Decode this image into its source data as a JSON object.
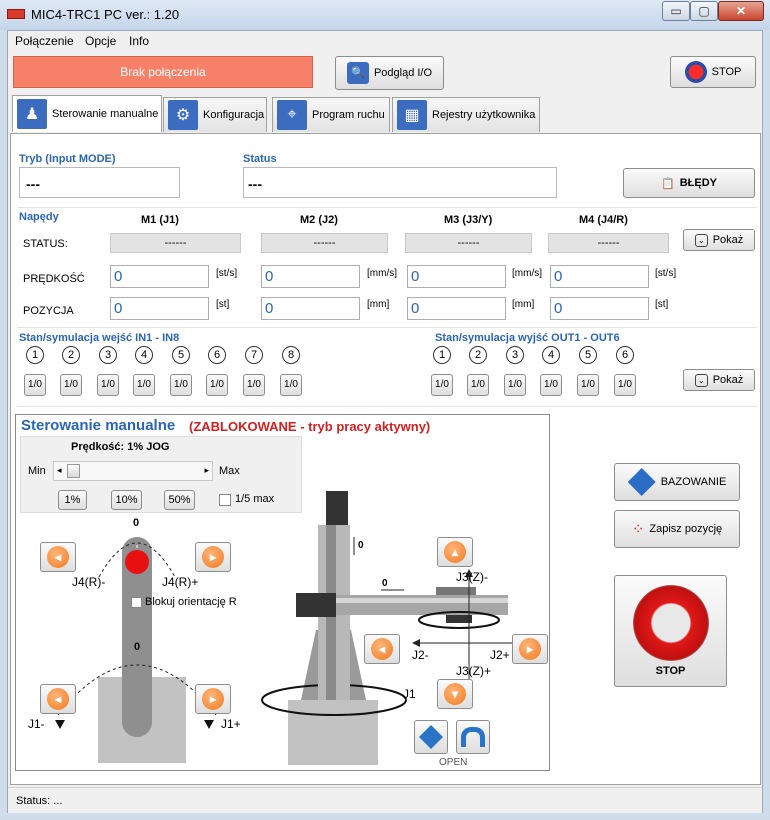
{
  "window": {
    "title": "MIC4-TRC1 PC  ver.: 1.20",
    "minimize": "▭",
    "maximize": "▢",
    "close": "✕"
  },
  "menu": [
    "Połączenie",
    "Opcje",
    "Info"
  ],
  "connection": {
    "status": "Brak połączenia"
  },
  "toolbar": {
    "io_preview": "Podgląd I/O",
    "stop": "STOP"
  },
  "tabs": [
    {
      "label": "Sterowanie manualne",
      "icon": "robot-icon"
    },
    {
      "label": "Konfiguracja",
      "icon": "gears-icon"
    },
    {
      "label": "Program ruchu",
      "icon": "path-icon"
    },
    {
      "label": "Rejestry użytkownika",
      "icon": "grid-icon"
    }
  ],
  "mode": {
    "label": "Tryb (Input MODE)",
    "value": "---"
  },
  "status": {
    "label": "Status",
    "value": "---"
  },
  "errors_button": "BŁĘDY",
  "drives": {
    "label": "Napędy",
    "show": "Pokaż",
    "row_labels": {
      "status": "STATUS:",
      "speed": "PRĘDKOŚĆ",
      "position": "POZYCJA"
    },
    "axes": [
      {
        "name": "M1 (J1)",
        "status": "------",
        "speed": "0",
        "speed_unit": "[st/s]",
        "position": "0",
        "position_unit": "[st]"
      },
      {
        "name": "M2 (J2)",
        "status": "------",
        "speed": "0",
        "speed_unit": "[mm/s]",
        "position": "0",
        "position_unit": "[mm]"
      },
      {
        "name": "M3 (J3/Y)",
        "status": "------",
        "speed": "0",
        "speed_unit": "[mm/s]",
        "position": "0",
        "position_unit": "[mm]"
      },
      {
        "name": "M4 (J4/R)",
        "status": "------",
        "speed": "0",
        "speed_unit": "[st/s]",
        "position": "0",
        "position_unit": "[st]"
      }
    ]
  },
  "inputs": {
    "label": "Stan/symulacja wejść IN1 - IN8",
    "numbers": [
      "1",
      "2",
      "3",
      "4",
      "5",
      "6",
      "7",
      "8"
    ],
    "button": "1/0"
  },
  "outputs": {
    "label": "Stan/symulacja wyjść OUT1 - OUT6",
    "numbers": [
      "1",
      "2",
      "3",
      "4",
      "5",
      "6"
    ],
    "button": "1/0",
    "show": "Pokaż"
  },
  "manual": {
    "title": "Sterowanie manualne",
    "locked": "(ZABLOKOWANE - tryb pracy aktywny)",
    "speed_label": "Prędkość:  1% JOG",
    "speed_percent": 0.01,
    "min": "Min",
    "max": "Max",
    "presets": [
      "1%",
      "10%",
      "50%"
    ],
    "fifth_max": "1/5 max",
    "j4_minus": "J4(R)-",
    "j4_plus": "J4(R)+",
    "lock_orientation": "Blokuj orientację R",
    "j1_minus": "J1-",
    "j1_plus": "J1+",
    "j1": "J1",
    "j2_minus": "J2-",
    "j2_plus": "J2+",
    "j3_minus": "J3(Z)-",
    "j3_plus": "J3(Z)+",
    "zero": "0",
    "open": "OPEN"
  },
  "homing": "BAZOWANIE",
  "save_position": "Zapisz pozycję",
  "stop_big": "STOP",
  "statusbar": "Status:  ..."
}
